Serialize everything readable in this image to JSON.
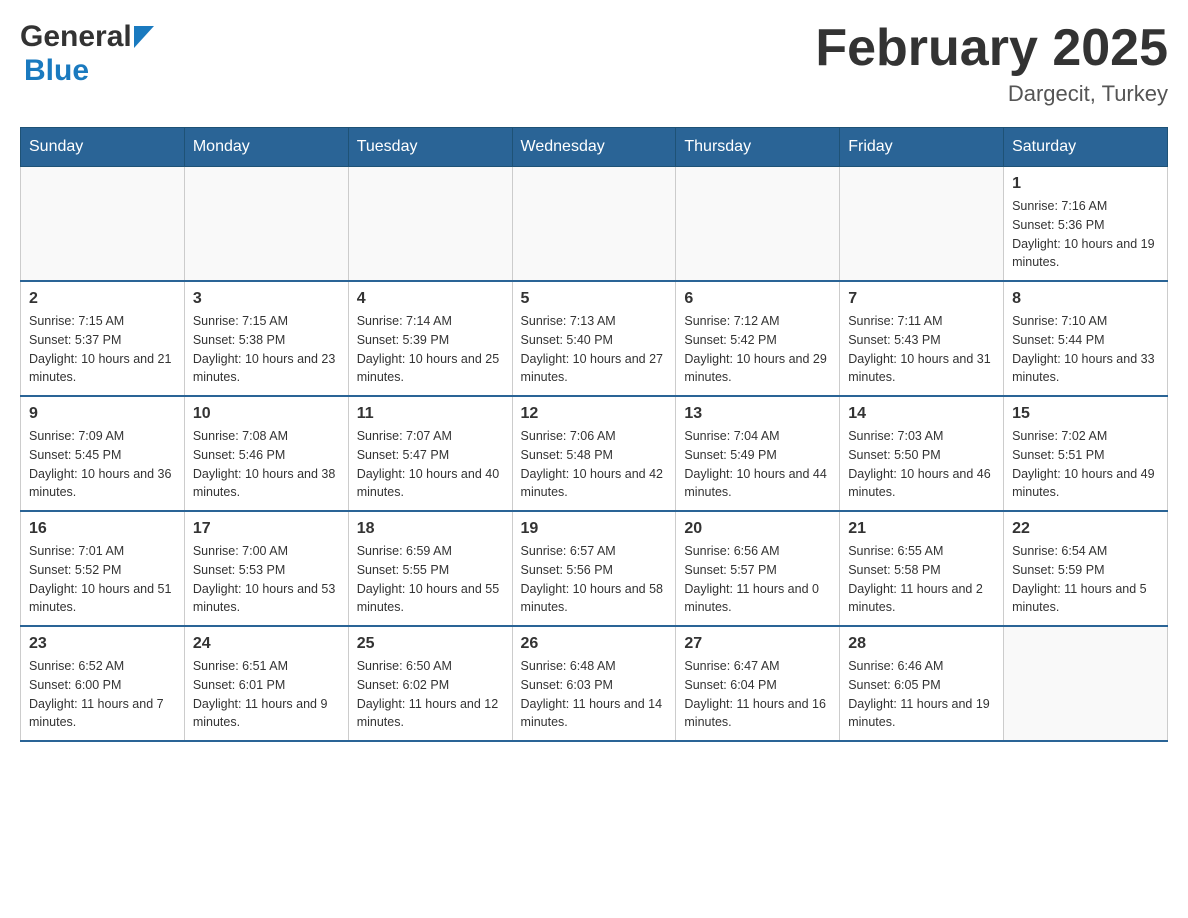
{
  "header": {
    "logo_general": "General",
    "logo_blue": "Blue",
    "title": "February 2025",
    "subtitle": "Dargecit, Turkey"
  },
  "days_of_week": [
    "Sunday",
    "Monday",
    "Tuesday",
    "Wednesday",
    "Thursday",
    "Friday",
    "Saturday"
  ],
  "weeks": [
    [
      {
        "day": "",
        "sunrise": "",
        "sunset": "",
        "daylight": ""
      },
      {
        "day": "",
        "sunrise": "",
        "sunset": "",
        "daylight": ""
      },
      {
        "day": "",
        "sunrise": "",
        "sunset": "",
        "daylight": ""
      },
      {
        "day": "",
        "sunrise": "",
        "sunset": "",
        "daylight": ""
      },
      {
        "day": "",
        "sunrise": "",
        "sunset": "",
        "daylight": ""
      },
      {
        "day": "",
        "sunrise": "",
        "sunset": "",
        "daylight": ""
      },
      {
        "day": "1",
        "sunrise": "Sunrise: 7:16 AM",
        "sunset": "Sunset: 5:36 PM",
        "daylight": "Daylight: 10 hours and 19 minutes."
      }
    ],
    [
      {
        "day": "2",
        "sunrise": "Sunrise: 7:15 AM",
        "sunset": "Sunset: 5:37 PM",
        "daylight": "Daylight: 10 hours and 21 minutes."
      },
      {
        "day": "3",
        "sunrise": "Sunrise: 7:15 AM",
        "sunset": "Sunset: 5:38 PM",
        "daylight": "Daylight: 10 hours and 23 minutes."
      },
      {
        "day": "4",
        "sunrise": "Sunrise: 7:14 AM",
        "sunset": "Sunset: 5:39 PM",
        "daylight": "Daylight: 10 hours and 25 minutes."
      },
      {
        "day": "5",
        "sunrise": "Sunrise: 7:13 AM",
        "sunset": "Sunset: 5:40 PM",
        "daylight": "Daylight: 10 hours and 27 minutes."
      },
      {
        "day": "6",
        "sunrise": "Sunrise: 7:12 AM",
        "sunset": "Sunset: 5:42 PM",
        "daylight": "Daylight: 10 hours and 29 minutes."
      },
      {
        "day": "7",
        "sunrise": "Sunrise: 7:11 AM",
        "sunset": "Sunset: 5:43 PM",
        "daylight": "Daylight: 10 hours and 31 minutes."
      },
      {
        "day": "8",
        "sunrise": "Sunrise: 7:10 AM",
        "sunset": "Sunset: 5:44 PM",
        "daylight": "Daylight: 10 hours and 33 minutes."
      }
    ],
    [
      {
        "day": "9",
        "sunrise": "Sunrise: 7:09 AM",
        "sunset": "Sunset: 5:45 PM",
        "daylight": "Daylight: 10 hours and 36 minutes."
      },
      {
        "day": "10",
        "sunrise": "Sunrise: 7:08 AM",
        "sunset": "Sunset: 5:46 PM",
        "daylight": "Daylight: 10 hours and 38 minutes."
      },
      {
        "day": "11",
        "sunrise": "Sunrise: 7:07 AM",
        "sunset": "Sunset: 5:47 PM",
        "daylight": "Daylight: 10 hours and 40 minutes."
      },
      {
        "day": "12",
        "sunrise": "Sunrise: 7:06 AM",
        "sunset": "Sunset: 5:48 PM",
        "daylight": "Daylight: 10 hours and 42 minutes."
      },
      {
        "day": "13",
        "sunrise": "Sunrise: 7:04 AM",
        "sunset": "Sunset: 5:49 PM",
        "daylight": "Daylight: 10 hours and 44 minutes."
      },
      {
        "day": "14",
        "sunrise": "Sunrise: 7:03 AM",
        "sunset": "Sunset: 5:50 PM",
        "daylight": "Daylight: 10 hours and 46 minutes."
      },
      {
        "day": "15",
        "sunrise": "Sunrise: 7:02 AM",
        "sunset": "Sunset: 5:51 PM",
        "daylight": "Daylight: 10 hours and 49 minutes."
      }
    ],
    [
      {
        "day": "16",
        "sunrise": "Sunrise: 7:01 AM",
        "sunset": "Sunset: 5:52 PM",
        "daylight": "Daylight: 10 hours and 51 minutes."
      },
      {
        "day": "17",
        "sunrise": "Sunrise: 7:00 AM",
        "sunset": "Sunset: 5:53 PM",
        "daylight": "Daylight: 10 hours and 53 minutes."
      },
      {
        "day": "18",
        "sunrise": "Sunrise: 6:59 AM",
        "sunset": "Sunset: 5:55 PM",
        "daylight": "Daylight: 10 hours and 55 minutes."
      },
      {
        "day": "19",
        "sunrise": "Sunrise: 6:57 AM",
        "sunset": "Sunset: 5:56 PM",
        "daylight": "Daylight: 10 hours and 58 minutes."
      },
      {
        "day": "20",
        "sunrise": "Sunrise: 6:56 AM",
        "sunset": "Sunset: 5:57 PM",
        "daylight": "Daylight: 11 hours and 0 minutes."
      },
      {
        "day": "21",
        "sunrise": "Sunrise: 6:55 AM",
        "sunset": "Sunset: 5:58 PM",
        "daylight": "Daylight: 11 hours and 2 minutes."
      },
      {
        "day": "22",
        "sunrise": "Sunrise: 6:54 AM",
        "sunset": "Sunset: 5:59 PM",
        "daylight": "Daylight: 11 hours and 5 minutes."
      }
    ],
    [
      {
        "day": "23",
        "sunrise": "Sunrise: 6:52 AM",
        "sunset": "Sunset: 6:00 PM",
        "daylight": "Daylight: 11 hours and 7 minutes."
      },
      {
        "day": "24",
        "sunrise": "Sunrise: 6:51 AM",
        "sunset": "Sunset: 6:01 PM",
        "daylight": "Daylight: 11 hours and 9 minutes."
      },
      {
        "day": "25",
        "sunrise": "Sunrise: 6:50 AM",
        "sunset": "Sunset: 6:02 PM",
        "daylight": "Daylight: 11 hours and 12 minutes."
      },
      {
        "day": "26",
        "sunrise": "Sunrise: 6:48 AM",
        "sunset": "Sunset: 6:03 PM",
        "daylight": "Daylight: 11 hours and 14 minutes."
      },
      {
        "day": "27",
        "sunrise": "Sunrise: 6:47 AM",
        "sunset": "Sunset: 6:04 PM",
        "daylight": "Daylight: 11 hours and 16 minutes."
      },
      {
        "day": "28",
        "sunrise": "Sunrise: 6:46 AM",
        "sunset": "Sunset: 6:05 PM",
        "daylight": "Daylight: 11 hours and 19 minutes."
      },
      {
        "day": "",
        "sunrise": "",
        "sunset": "",
        "daylight": ""
      }
    ]
  ]
}
